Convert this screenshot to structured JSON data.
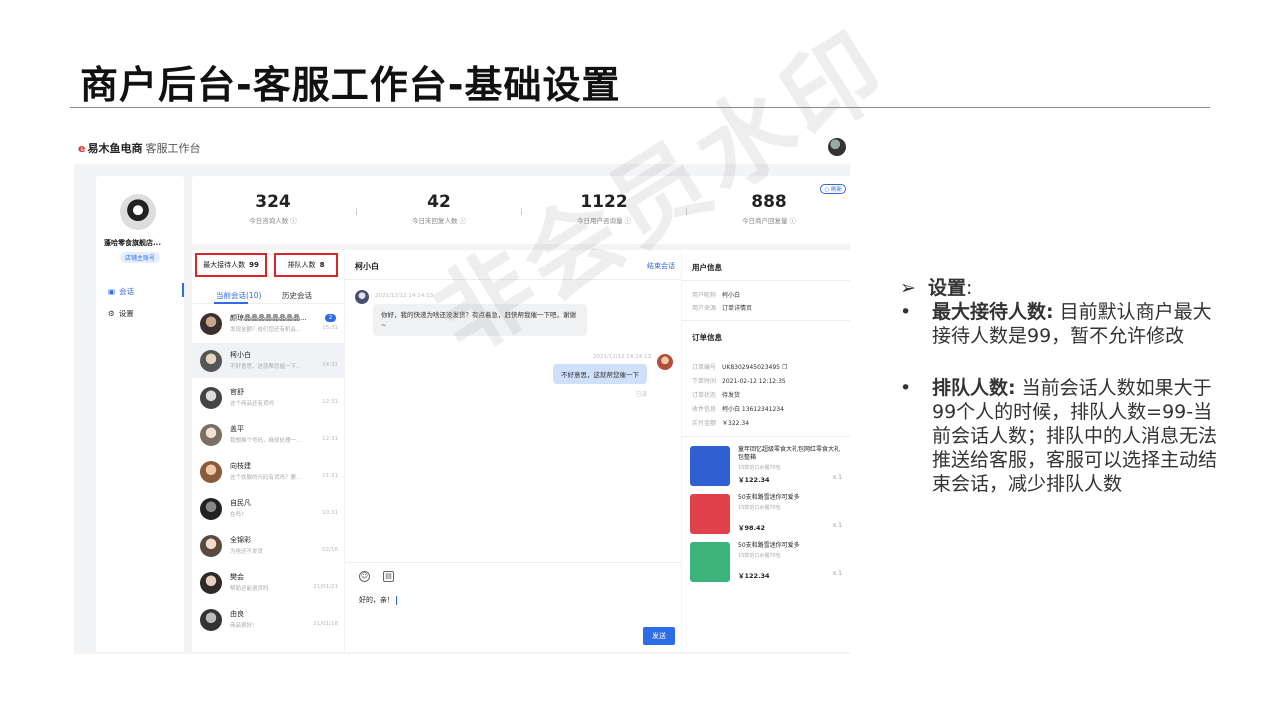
{
  "slide": {
    "title": "商户后台-客服工作台-基础设置"
  },
  "app": {
    "brand": "易木鱼电商",
    "brand_mark": "e",
    "subtitle": "客服工作台",
    "shop_name": "蓬哈零食旗舰店...",
    "shop_badge": "店铺主账号"
  },
  "nav": {
    "items": [
      {
        "icon": "chat-icon",
        "glyph": "▣",
        "label": "会话"
      },
      {
        "icon": "gear-icon",
        "glyph": "⚙",
        "label": "设置"
      }
    ]
  },
  "stats": {
    "items": [
      {
        "value": "324",
        "label": "今日咨询人数 ⓘ"
      },
      {
        "value": "42",
        "label": "今日未回复人数 ⓘ"
      },
      {
        "value": "1122",
        "label": "今日用户咨询量 ⓘ"
      },
      {
        "value": "888",
        "label": "今日商户回复量 ⓘ"
      }
    ],
    "refresh_label": "○ 刷新"
  },
  "counters": {
    "max_label": "最大接待人数",
    "max_value": "99",
    "queue_label": "排队人数",
    "queue_value": "8"
  },
  "conv_tabs": {
    "current": "当前会话(10)",
    "history": "历史会话"
  },
  "conversations": [
    {
      "name": "颜琼晶晶晶晶晶晶晶晶...",
      "preview": "发现金额？给们您还有机会...",
      "time": "15:31",
      "badge": "2"
    },
    {
      "name": "柯小白",
      "preview": "不好意思，这就帮您催一下...",
      "time": "14:31",
      "badge": ""
    },
    {
      "name": "官舒",
      "preview": "这个商品还有货吗",
      "time": "12:31",
      "badge": ""
    },
    {
      "name": "盖平",
      "preview": "我想换个号码，麻烦处理一...",
      "time": "12:31",
      "badge": ""
    },
    {
      "name": "向枝建",
      "preview": "这个衣服的尺码有货吗？要...",
      "time": "11:31",
      "badge": ""
    },
    {
      "name": "自民凡",
      "preview": "在吗?",
      "time": "10:31",
      "badge": ""
    },
    {
      "name": "全锦彩",
      "preview": "为啥还不发货",
      "time": "02/16",
      "badge": ""
    },
    {
      "name": "樊会",
      "preview": "帮助还能退货吗",
      "time": "21/01/21",
      "badge": ""
    },
    {
      "name": "由良",
      "preview": "商品很好!",
      "time": "21/01/18",
      "badge": ""
    }
  ],
  "chat": {
    "title": "柯小白",
    "end_label": "结束会话",
    "incoming_time": "2021/12/12 14:14:13",
    "incoming_text": "你好，我的快递为啥还没发货？有点着急，赶快帮我催一下吧，谢谢~",
    "outgoing_time": "2021/12/12 14:14:13",
    "outgoing_text": "不好意思，这就帮您催一下",
    "read_label": "已读",
    "input_text": "好的，亲！",
    "send_label": "发送"
  },
  "user_info": {
    "heading": "用户信息",
    "rows": [
      {
        "k": "用户昵称",
        "v": "柯小白"
      },
      {
        "k": "用户来源",
        "v": "订单详情页"
      }
    ]
  },
  "order_info": {
    "heading": "订单信息",
    "rows": [
      {
        "k": "订单编号",
        "v": "UK8302945023495 ❐"
      },
      {
        "k": "下单时间",
        "v": "2021-02-12  12:12:35"
      },
      {
        "k": "订单状态",
        "v": "待发货"
      },
      {
        "k": "收件信息",
        "v": "柯小白  13612341234"
      },
      {
        "k": "实付金额",
        "v": "￥322.34"
      }
    ]
  },
  "products": [
    {
      "name": "童年回忆超级零食大礼包网红零食大礼包整箱",
      "spec": "15款进口水桶70包",
      "price": "￥122.34",
      "qty": "x 1",
      "color": "#2f5fd0"
    },
    {
      "name": "50支和路雪迷你可爱多",
      "spec": "15款进口水桶70包",
      "price": "￥98.42",
      "qty": "x 1",
      "color": "#e0414b"
    },
    {
      "name": "50支和路雪迷你可爱多",
      "spec": "15款进口水桶70包",
      "price": "￥122.34",
      "qty": "x 1",
      "color": "#3bb37a"
    }
  ],
  "watermark": "非会员水印",
  "notes": {
    "head_arrow": "➢",
    "head": "设置",
    "head_colon": ":",
    "bullets": [
      {
        "term": "最大接待人数:",
        "text": "目前默认商户最大接待人数是99，暂不允许修改"
      },
      {
        "term": "排队人数:",
        "text": "当前会话人数如果大于99个人的时候，排队人数=99-当前会话人数；排队中的人消息无法推送给客服，客服可以选择主动结束会话，减少排队人数"
      }
    ]
  }
}
